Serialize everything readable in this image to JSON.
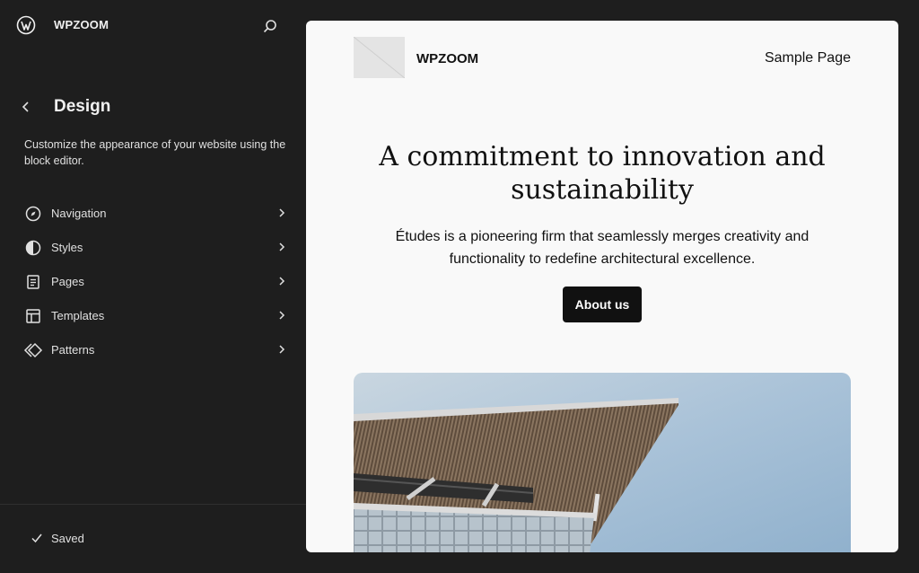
{
  "sidebar": {
    "site_name": "WPZOOM",
    "title": "Design",
    "description": "Customize the appearance of your website using the block editor.",
    "items": [
      {
        "label": "Navigation",
        "icon": "compass-icon"
      },
      {
        "label": "Styles",
        "icon": "half-circle-icon"
      },
      {
        "label": "Pages",
        "icon": "page-icon"
      },
      {
        "label": "Templates",
        "icon": "layout-icon"
      },
      {
        "label": "Patterns",
        "icon": "diamond-icon"
      }
    ],
    "status": "Saved"
  },
  "preview": {
    "site_title": "WPZOOM",
    "nav_link": "Sample Page",
    "hero_title": "A commitment to innovation and sustainability",
    "hero_text": "Études is a pioneering firm that seamlessly merges creativity and functionality to redefine architectural excellence.",
    "button_label": "About us"
  },
  "colors": {
    "sidebar_bg": "#1e1e1e",
    "canvas_bg": "#f9f9f9",
    "button_bg": "#111111",
    "sky": "#9fbbd3"
  }
}
